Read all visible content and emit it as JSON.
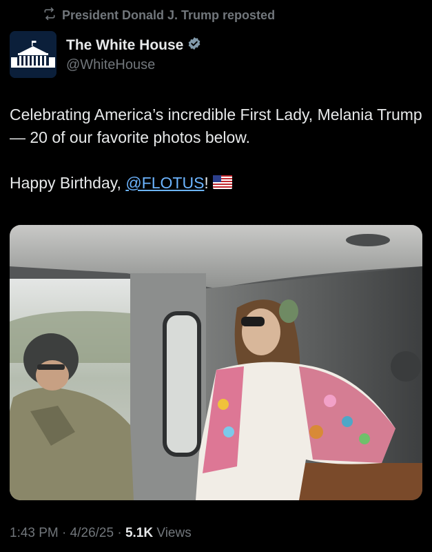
{
  "repost": {
    "icon": "repost-icon",
    "text": "President Donald J. Trump reposted"
  },
  "author": {
    "avatar_icon": "white-house-logo",
    "name": "The White House",
    "verified_icon": "verified-badge-icon",
    "handle": "@WhiteHouse"
  },
  "tweet": {
    "line1": "Celebrating America’s incredible First Lady, Melania Trump — 20 of our favorite photos below.",
    "line2_prefix": "Happy Birthday, ",
    "mention": "@FLOTUS",
    "line2_suffix": "!",
    "flag_icon": "us-flag-emoji"
  },
  "media": {
    "icon": "photo"
  },
  "meta": {
    "time": "1:43 PM",
    "sep1": " · ",
    "date": "4/26/25",
    "sep2": " · ",
    "views_count": "5.1K",
    "views_label": " Views"
  },
  "colors": {
    "background": "#000000",
    "text": "#e7e9ea",
    "muted": "#71767b",
    "link": "#6cb4ff",
    "verified": "#829aab"
  }
}
